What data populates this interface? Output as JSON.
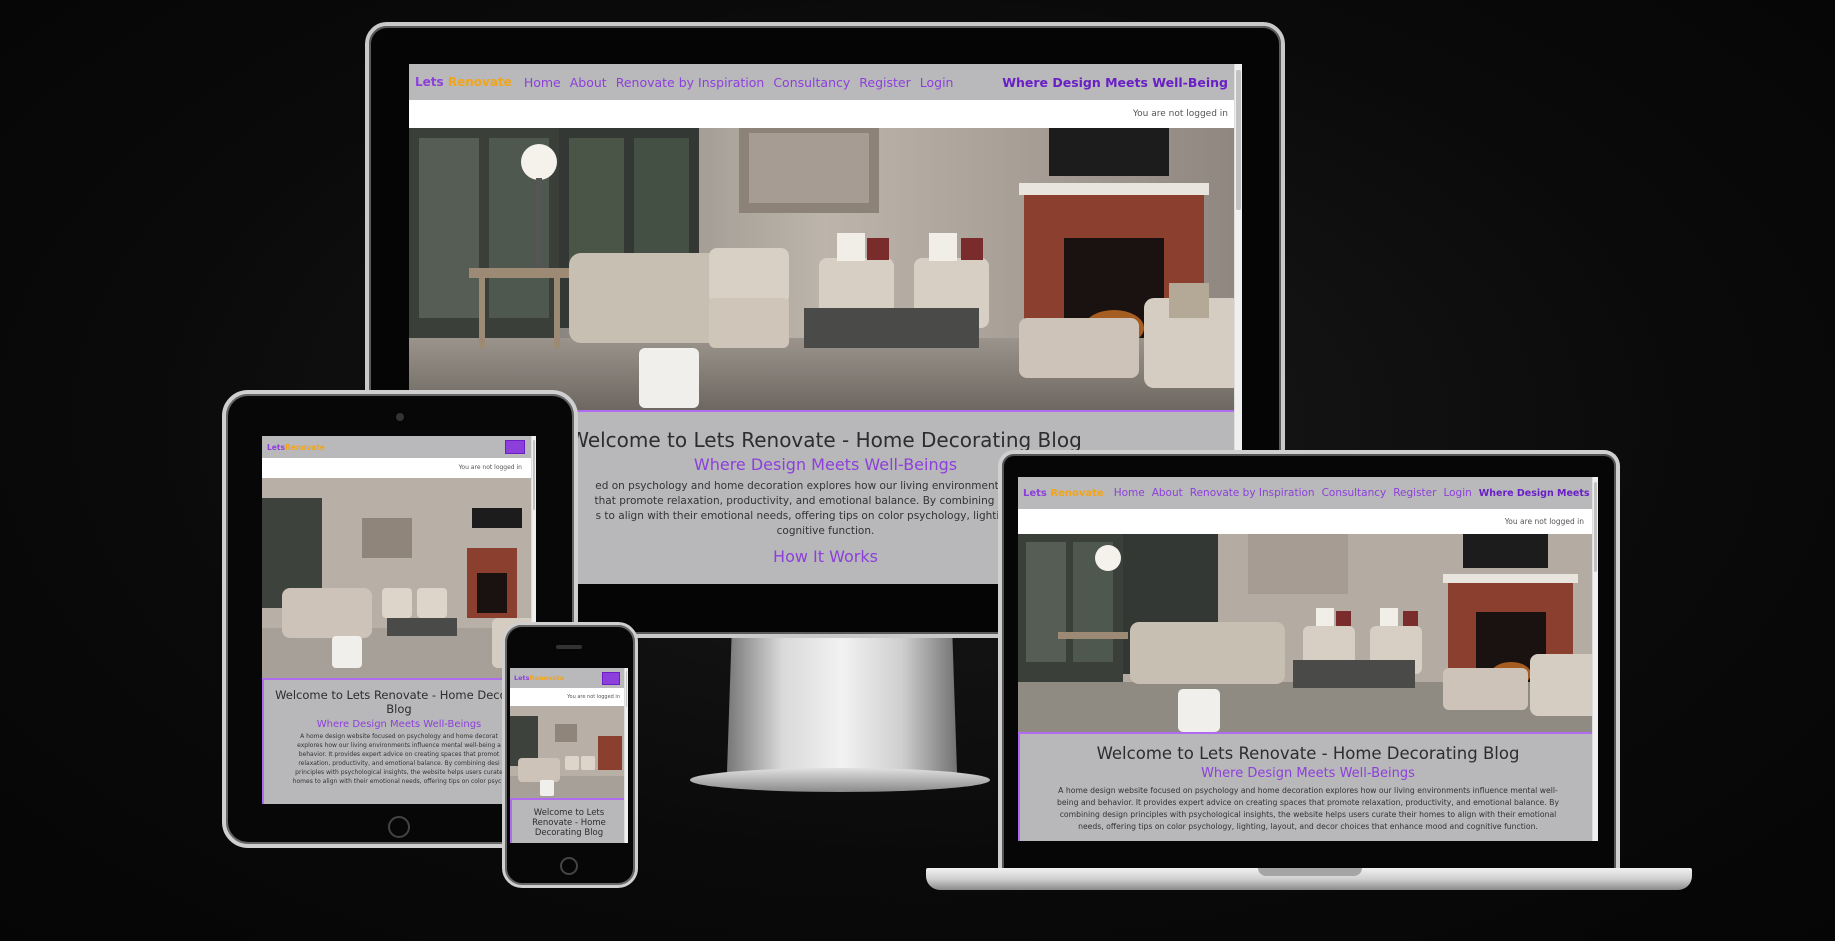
{
  "site": {
    "brand_part1": "Lets",
    "brand_part2": "Renovate",
    "nav": [
      "Home",
      "About",
      "Renovate by Inspiration",
      "Consultancy",
      "Register",
      "Login"
    ],
    "tagline": "Where Design Meets Well-Being",
    "status": "You are not logged in",
    "heading": "Welcome to Lets Renovate - Home Decorating Blog",
    "subheading": "Where Design Meets Well-Beings",
    "how_it_works": "How It Works",
    "desktop_para": [
      "ed on psychology and home decoration explores how our living environments influence",
      "that promote relaxation, productivity, and emotional balance. By combining design prin",
      "s to align with their emotional needs, offering tips on color psychology, lighting, layout,",
      "cognitive function."
    ],
    "laptop_para": [
      "A home design website focused on psychology and home decoration explores how our living environments influence mental well-",
      "being and behavior. It provides expert advice on creating spaces that promote relaxation, productivity, and emotional balance. By",
      "combining design principles with psychological insights, the website helps users curate their homes to align with their emotional",
      "needs, offering tips on color psychology, lighting, layout, and decor choices that enhance mood and cognitive function."
    ],
    "tablet_heading": [
      "Welcome to Lets Renovate - Home Decorat",
      "Blog"
    ],
    "tablet_para": [
      "A home design website focused on psychology and home decorat",
      "explores how our living environments influence mental well-being a",
      "behavior. It provides expert advice on creating spaces that promot",
      "relaxation, productivity, and emotional balance. By combining desi",
      "principles with psychological insights, the website helps users curate",
      "homes to align with their emotional needs, offering tips on color psych"
    ],
    "phone_heading": [
      "Welcome to Lets",
      "Renovate - Home",
      "Decorating Blog"
    ]
  },
  "colors": {
    "accent": "#8d3fdb",
    "brand_orange": "#f2a51a",
    "nav_bg": "#b9b9bb",
    "content_bg": "#b8b8ba"
  }
}
